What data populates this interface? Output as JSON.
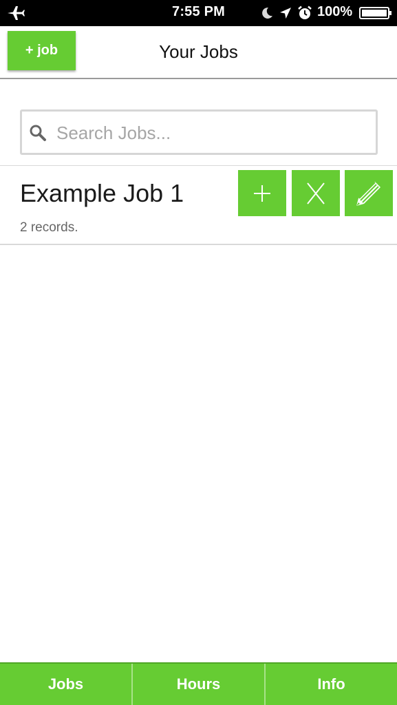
{
  "status_bar": {
    "time": "7:55 PM",
    "battery_percent": "100%",
    "icons": [
      "airplane-icon",
      "moon-icon",
      "location-arrow-icon",
      "alarm-icon",
      "battery-icon"
    ]
  },
  "header": {
    "add_job_label": "+ job",
    "title": "Your Jobs"
  },
  "search": {
    "placeholder": "Search Jobs...",
    "value": ""
  },
  "jobs": [
    {
      "name": "Example Job 1",
      "records_text": "2 records.",
      "actions": [
        {
          "icon": "plus-icon"
        },
        {
          "icon": "x-icon"
        },
        {
          "icon": "pencil-icon"
        }
      ]
    }
  ],
  "tab_bar": {
    "tabs": [
      {
        "label": "Jobs"
      },
      {
        "label": "Hours"
      },
      {
        "label": "Info"
      }
    ]
  },
  "colors": {
    "accent_green": "#66cc33",
    "status_bar_bg": "#000000",
    "background": "#ffffff"
  }
}
